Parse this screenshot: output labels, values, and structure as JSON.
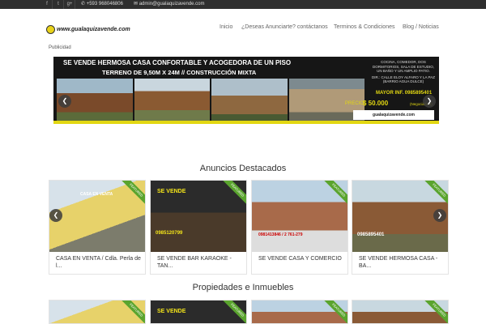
{
  "topbar": {
    "social": [
      {
        "icon": "facebook-icon",
        "glyph": "f"
      },
      {
        "icon": "twitter-icon",
        "glyph": "t"
      },
      {
        "icon": "googleplus-icon",
        "glyph": "g+"
      }
    ],
    "phone": "+593 968046806",
    "email": "admin@gualaquizavende.com"
  },
  "logo": {
    "text": "www.gualaquizavende.com"
  },
  "nav": [
    "Inicio",
    "¿Deseas Anunciarte? contáctanos",
    "Terminos & Condiciones",
    "Blog / Noticias"
  ],
  "publicidad": "Publicidad",
  "banner": {
    "title": "SE VENDE HERMOSA CASA CONFORTABLE Y ACOGEDORA DE UN PISO",
    "subtitle": "TERRENO DE 9,50M X 24M // CONSTRUCCIÓN MIXTA",
    "details": "COCINA, COMEDOR, DOS DORMITORIOS, SALA DE ESTUDIO, UN BAÑO Y UN AMPLIO PATIO.",
    "address": "DIR.: CALLE ELOY ALFARO Y LA PAZ (BARRIO AGUA DULCE)",
    "mayor": "MAYOR INF. 0985895401",
    "precio_label": "PRECIO",
    "precio": "$ 50.000",
    "negociable": "(Negociables)",
    "brand": "gualaquizavende.com"
  },
  "sections": {
    "destacados": "Anuncios Destacados",
    "propiedades": "Propiedades e Inmuebles"
  },
  "featured_ribbon": "FEATURED",
  "cards": [
    {
      "caption": "CASA EN VENTA / Cdla. Perla de l...",
      "img_text": "CASA EN VENTA",
      "phone": ""
    },
    {
      "caption": "SE VENDE BAR KARAOKE - TAN...",
      "img_text": "SE VENDE",
      "phone": "0985120799"
    },
    {
      "caption": "SE VENDE CASA Y COMERCIO",
      "img_text": "",
      "phone": "0981413846 / 2 761-279"
    },
    {
      "caption": "SE VENDE HERMOSA CASA - BA...",
      "img_text": "",
      "phone": "0985895401"
    }
  ],
  "colors": {
    "accent_yellow": "#e2d712",
    "ribbon_green": "#5aa42e",
    "topbar": "#2f2f2f"
  }
}
